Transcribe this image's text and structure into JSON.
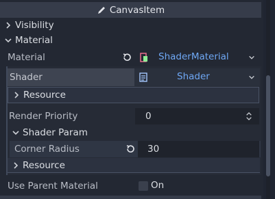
{
  "header": {
    "title": "CanvasItem",
    "icon": "pencil-icon"
  },
  "categories": {
    "visibility": "Visibility",
    "material": "Material"
  },
  "material_prop": {
    "label": "Material",
    "value": "ShaderMaterial"
  },
  "shader_prop": {
    "label": "Shader",
    "value": "Shader"
  },
  "shader_resource": "Resource",
  "render_priority": {
    "label": "Render Priority",
    "value": "0"
  },
  "shader_param": {
    "title": "Shader Param"
  },
  "corner_radius": {
    "label": "Corner Radius",
    "value": "30"
  },
  "param_resource": "Resource",
  "use_parent_material": {
    "label": "Use Parent Material",
    "value": "On"
  },
  "colors": {
    "accent": "#6fa8f5",
    "panel": "#232833",
    "header": "#363c4a"
  }
}
